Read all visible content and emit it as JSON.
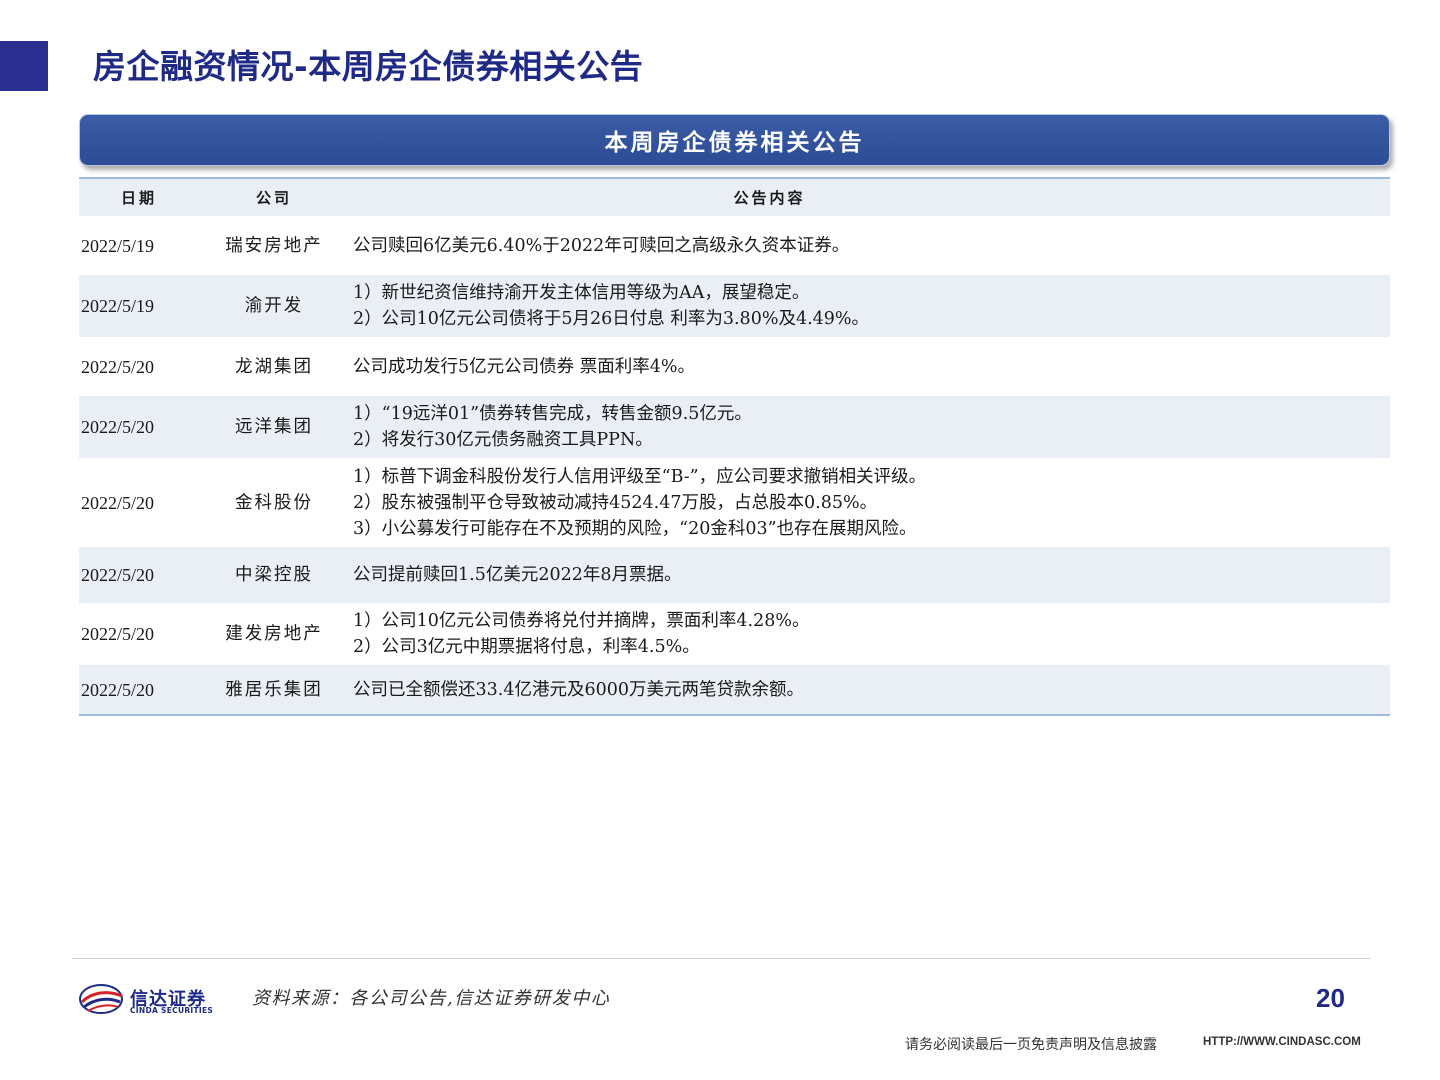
{
  "header": {
    "title": "房企融资情况-本周房企债券相关公告"
  },
  "banner": {
    "title": "本周房企债券相关公告"
  },
  "table": {
    "columns": [
      "日期",
      "公司",
      "公告内容"
    ],
    "rows": [
      {
        "date": "2022/5/19",
        "company": "瑞安房地产",
        "lines": [
          "公司赎回6亿美元6.40%于2022年可赎回之高级永久资本证券。"
        ]
      },
      {
        "date": "2022/5/19",
        "company": "渝开发",
        "lines": [
          "1）新世纪资信维持渝开发主体信用等级为AA，展望稳定。",
          "2）公司10亿元公司债将于5月26日付息 利率为3.80%及4.49%。"
        ]
      },
      {
        "date": "2022/5/20",
        "company": "龙湖集团",
        "lines": [
          "公司成功发行5亿元公司债券 票面利率4%。"
        ]
      },
      {
        "date": "2022/5/20",
        "company": "远洋集团",
        "lines": [
          "1）“19远洋01”债券转售完成，转售金额9.5亿元。",
          "2）将发行30亿元债务融资工具PPN。"
        ]
      },
      {
        "date": "2022/5/20",
        "company": "金科股份",
        "lines": [
          "1）标普下调金科股份发行人信用评级至“B-”，应公司要求撤销相关评级。",
          "2）股东被强制平仓导致被动减持4524.47万股，占总股本0.85%。",
          "3）小公募发行可能存在不及预期的风险，“20金科03”也存在展期风险。"
        ]
      },
      {
        "date": "2022/5/20",
        "company": "中梁控股",
        "lines": [
          "公司提前赎回1.5亿美元2022年8月票据。"
        ]
      },
      {
        "date": "2022/5/20",
        "company": "建发房地产",
        "lines": [
          "1）公司10亿元公司债券将兑付并摘牌，票面利率4.28%。",
          "2）公司3亿元中期票据将付息，利率4.5%。"
        ]
      },
      {
        "date": "2022/5/20",
        "company": "雅居乐集团",
        "lines": [
          "公司已全额偿还33.4亿港元及6000万美元两笔贷款余额。"
        ]
      }
    ]
  },
  "footer": {
    "logo_cn": "信达证券",
    "logo_en": "CINDA SECURITIES",
    "source": "资料来源：各公司公告,信达证券研发中心",
    "page_number": "20",
    "disclaimer": "请务必阅读最后一页免责声明及信息披露",
    "site": "HTTP://WWW.CINDASC.COM"
  },
  "colors": {
    "brand": "#1f2a86",
    "banner": "#2c4c95",
    "row_shade": "#eaeef5",
    "rule": "#9fbce0"
  }
}
